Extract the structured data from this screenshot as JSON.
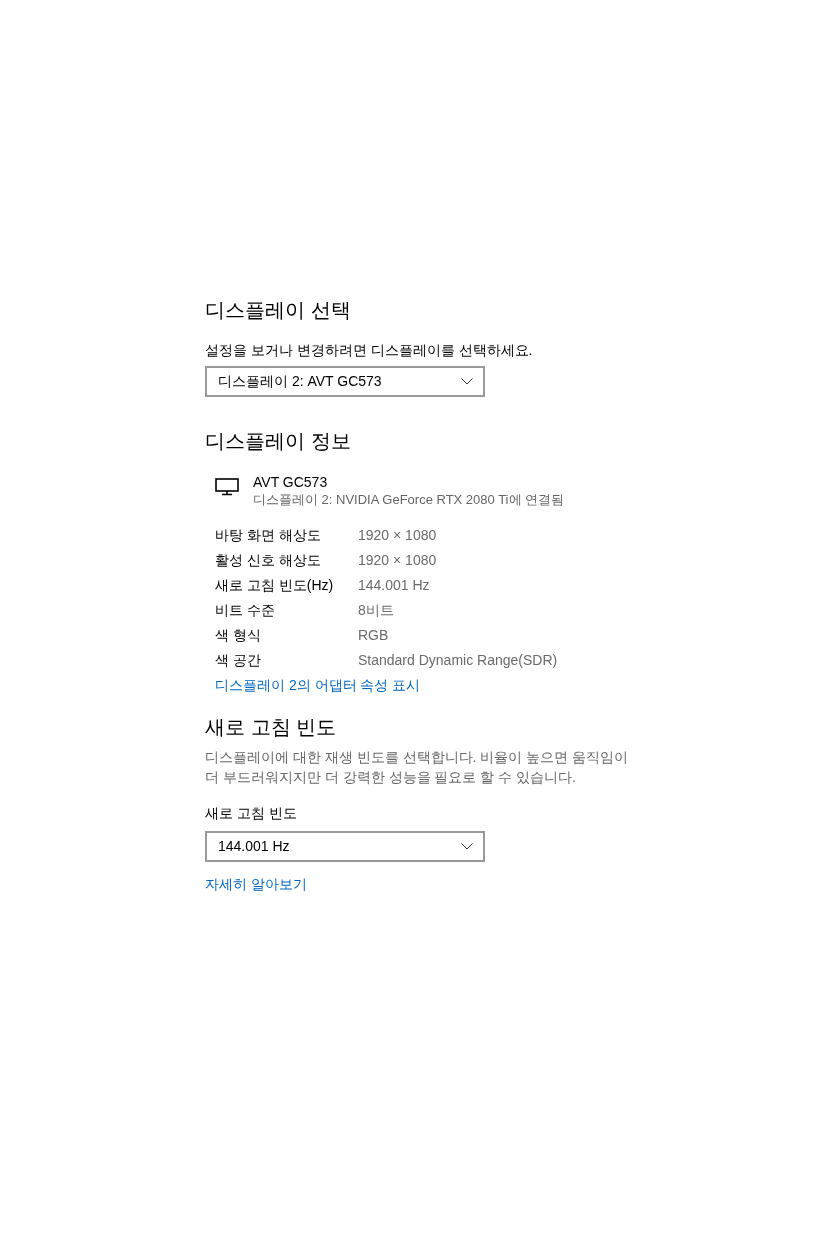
{
  "select_display": {
    "title": "디스플레이 선택",
    "description": "설정을 보거나 변경하려면 디스플레이를 선택하세요.",
    "dropdown": {
      "value": "디스플레이 2: AVT GC573"
    }
  },
  "display_info": {
    "title": "디스플레이 정보",
    "monitor": {
      "name": "AVT GC573",
      "connection": "디스플레이 2: NVIDIA GeForce RTX 2080 Ti에 연결됨"
    },
    "properties": [
      {
        "label": "바탕 화면 해상도",
        "value": "1920 × 1080"
      },
      {
        "label": "활성 신호 해상도",
        "value": "1920 × 1080"
      },
      {
        "label": "새로 고침 빈도(Hz)",
        "value": "144.001 Hz"
      },
      {
        "label": "비트 수준",
        "value": "8비트"
      },
      {
        "label": "색 형식",
        "value": "RGB"
      },
      {
        "label": "색 공간",
        "value": "Standard Dynamic Range(SDR)"
      }
    ],
    "link": "디스플레이 2의 어댑터 속성 표시"
  },
  "refresh_rate": {
    "title": "새로 고침 빈도",
    "description": "디스플레이에 대한 재생 빈도를 선택합니다. 비율이 높으면 움직임이 더 부드러워지지만 더 강력한 성능을 필요로 할 수 있습니다.",
    "field_label": "새로 고침 빈도",
    "dropdown": {
      "value": "144.001 Hz"
    },
    "link": "자세히 알아보기"
  }
}
